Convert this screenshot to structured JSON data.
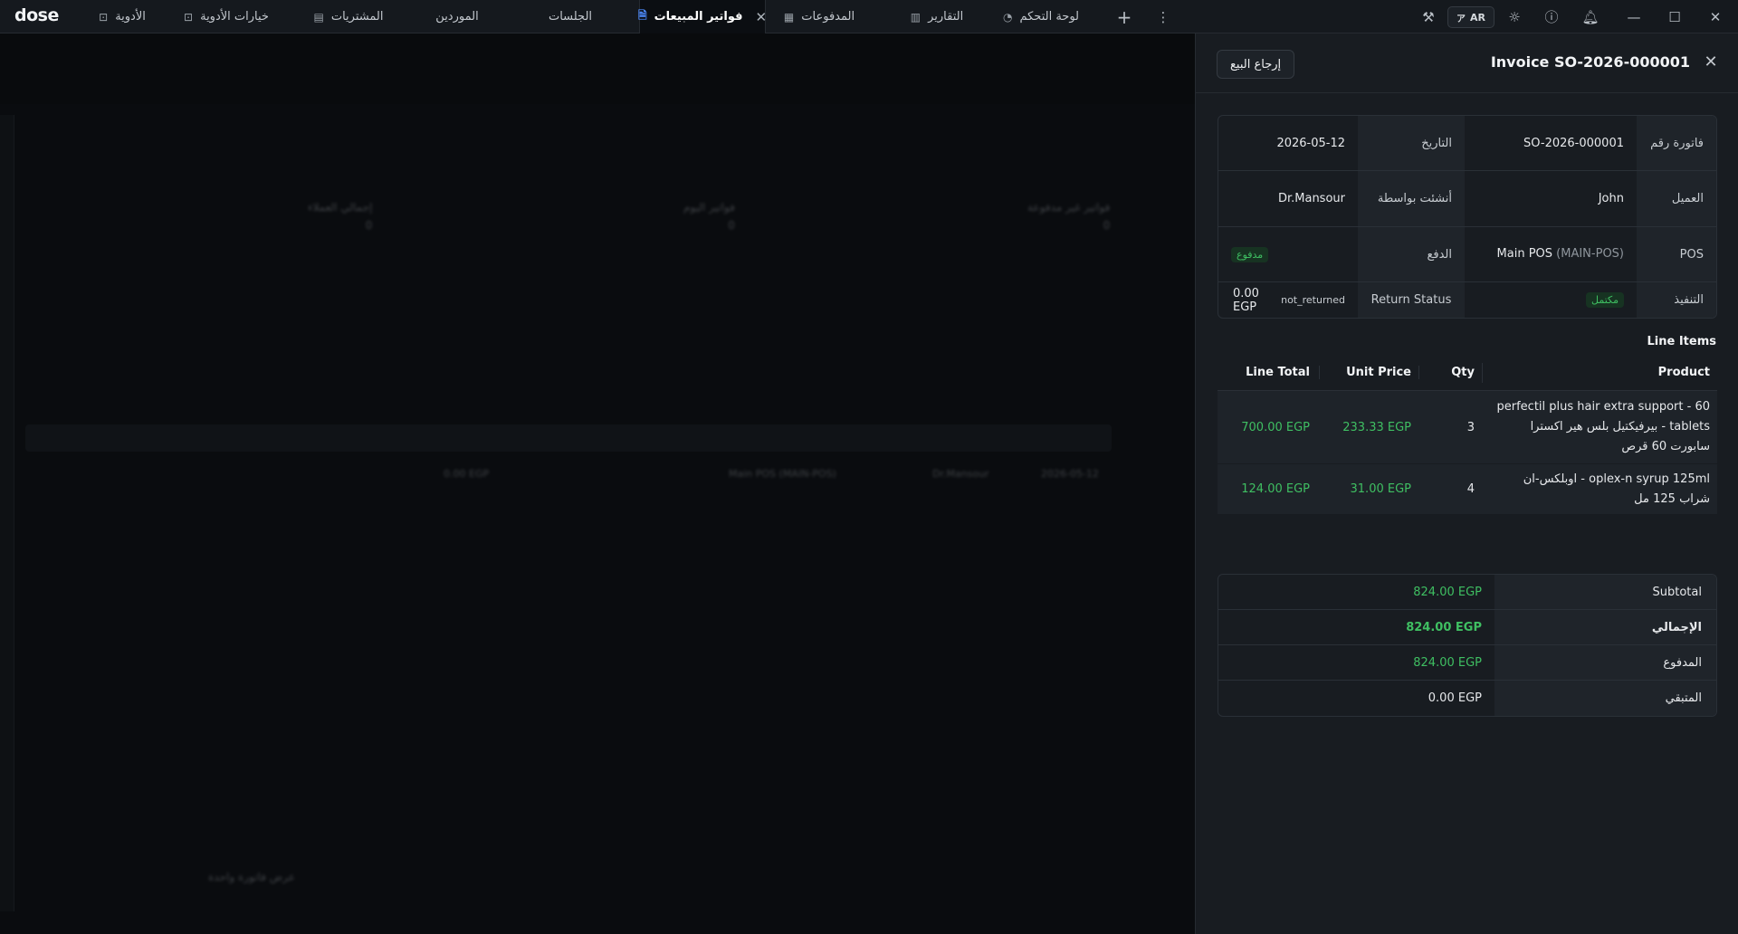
{
  "app": {
    "logo": "dose"
  },
  "tabs": [
    {
      "label": "الأدوية",
      "icon": "box-icon"
    },
    {
      "label": "خيارات الأدوية",
      "icon": "box-icon"
    },
    {
      "label": "المشتريات",
      "icon": "receipt-icon"
    },
    {
      "label": "الموردين",
      "icon": ""
    },
    {
      "label": "الجلسات",
      "icon": ""
    },
    {
      "label": "فواتير المبيعات",
      "icon": "document-icon",
      "active": true
    },
    {
      "label": "المدفوعات",
      "icon": "wallet-icon"
    },
    {
      "label": "التقارير",
      "icon": "chart-icon"
    },
    {
      "label": "لوحة التحكم",
      "icon": "dashboard-icon"
    }
  ],
  "toolbar": {
    "lang": "AR"
  },
  "background": {
    "stats": [
      {
        "label": "إجمالي العملاء",
        "value": "0"
      },
      {
        "label": "فواتير اليوم",
        "value": "0"
      },
      {
        "label": "فواتير غير مدفوعة",
        "value": "0"
      }
    ],
    "row_text": "Main POS (MAIN-POS)",
    "row_date": "2026-05-12",
    "row_by": "Dr.Mansour",
    "row_amount": "0.00 EGP",
    "footer": "عرض فاتورة واحدة"
  },
  "drawer": {
    "title": "Invoice SO-2026-000001",
    "return_button": "إرجاع البيع",
    "info": {
      "invoice_no_label": "فاتورة رقم",
      "invoice_no": "SO-2026-000001",
      "date_label": "التاريخ",
      "date": "2026-05-12",
      "customer_label": "العميل",
      "customer": "John",
      "created_by_label": "أنشئت بواسطة",
      "created_by": "Dr.Mansour",
      "pos_label": "POS",
      "pos_name": "Main POS",
      "pos_code": "(MAIN-POS)",
      "payment_label": "الدفع",
      "payment_status": "مدفوع",
      "fulfillment_label": "التنفيذ",
      "fulfillment_status": "مكتمل",
      "return_status_label": "Return Status",
      "return_status": "not_returned",
      "return_amount": "0.00 EGP"
    },
    "line_items": {
      "title": "Line Items",
      "headers": {
        "product": "Product",
        "qty": "Qty",
        "unit_price": "Unit Price",
        "line_total": "Line Total"
      },
      "rows": [
        {
          "product": "perfectil plus hair extra support - 60 tablets - بيرفيكتيل بلس هير اكسترا سابورت 60 قرص",
          "qty": "3",
          "unit_price": "233.33 EGP",
          "line_total": "700.00 EGP"
        },
        {
          "product": "oplex-n syrup 125ml - اوبلكس-ان شراب 125 مل",
          "qty": "4",
          "unit_price": "31.00 EGP",
          "line_total": "124.00 EGP"
        }
      ]
    },
    "totals": {
      "subtotal_label": "Subtotal",
      "subtotal": "824.00 EGP",
      "total_label": "الإجمالي",
      "total": "824.00 EGP",
      "paid_label": "المدفوع",
      "paid": "824.00 EGP",
      "remaining_label": "المتبقي",
      "remaining": "0.00 EGP"
    }
  }
}
